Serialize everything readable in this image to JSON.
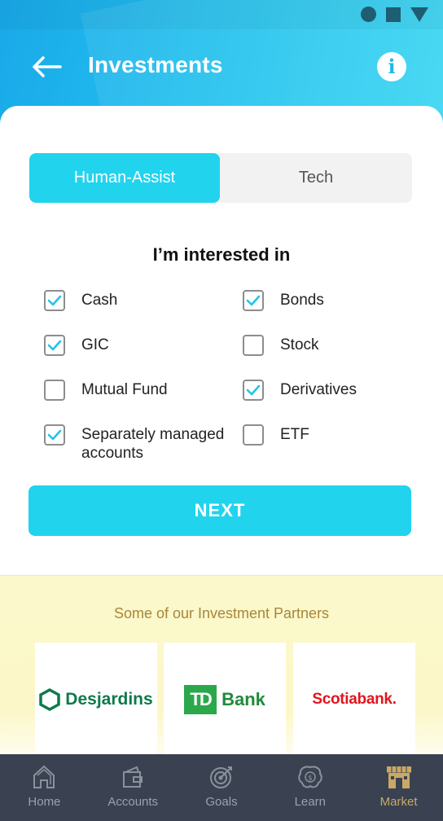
{
  "header": {
    "title": "Investments"
  },
  "segment": {
    "options": [
      "Human-Assist",
      "Tech"
    ],
    "selected": "Human-Assist"
  },
  "interests": {
    "title": "I’m interested in",
    "options": [
      {
        "label": "Cash",
        "checked": true
      },
      {
        "label": "Bonds",
        "checked": true
      },
      {
        "label": "GIC",
        "checked": true
      },
      {
        "label": "Stock",
        "checked": false
      },
      {
        "label": "Mutual Fund",
        "checked": false
      },
      {
        "label": "Derivatives",
        "checked": true
      },
      {
        "label": "Separately managed accounts",
        "checked": true
      },
      {
        "label": "ETF",
        "checked": false
      }
    ]
  },
  "next_button": "NEXT",
  "partners": {
    "title": "Some of our Investment Partners",
    "logos": [
      {
        "name": "Desjardins",
        "icon": "desjardins-hexagon-logo"
      },
      {
        "name": "TD Bank",
        "mark": "TD",
        "word": "Bank"
      },
      {
        "name": "Scotiabank."
      }
    ]
  },
  "tabbar": {
    "items": [
      {
        "label": "Home",
        "icon": "home-icon"
      },
      {
        "label": "Accounts",
        "icon": "wallet-icon"
      },
      {
        "label": "Goals",
        "icon": "target-icon"
      },
      {
        "label": "Learn",
        "icon": "brain-icon"
      },
      {
        "label": "Market",
        "icon": "market-icon"
      }
    ],
    "active": "Market"
  },
  "colors": {
    "accent": "#22d3ee",
    "header_gradient": [
      "#1aa9ea",
      "#3ad6f2"
    ],
    "partners_bg": "#fbf8cc",
    "tabbar_bg": "#3a4251",
    "tab_active": "#c9a867"
  }
}
